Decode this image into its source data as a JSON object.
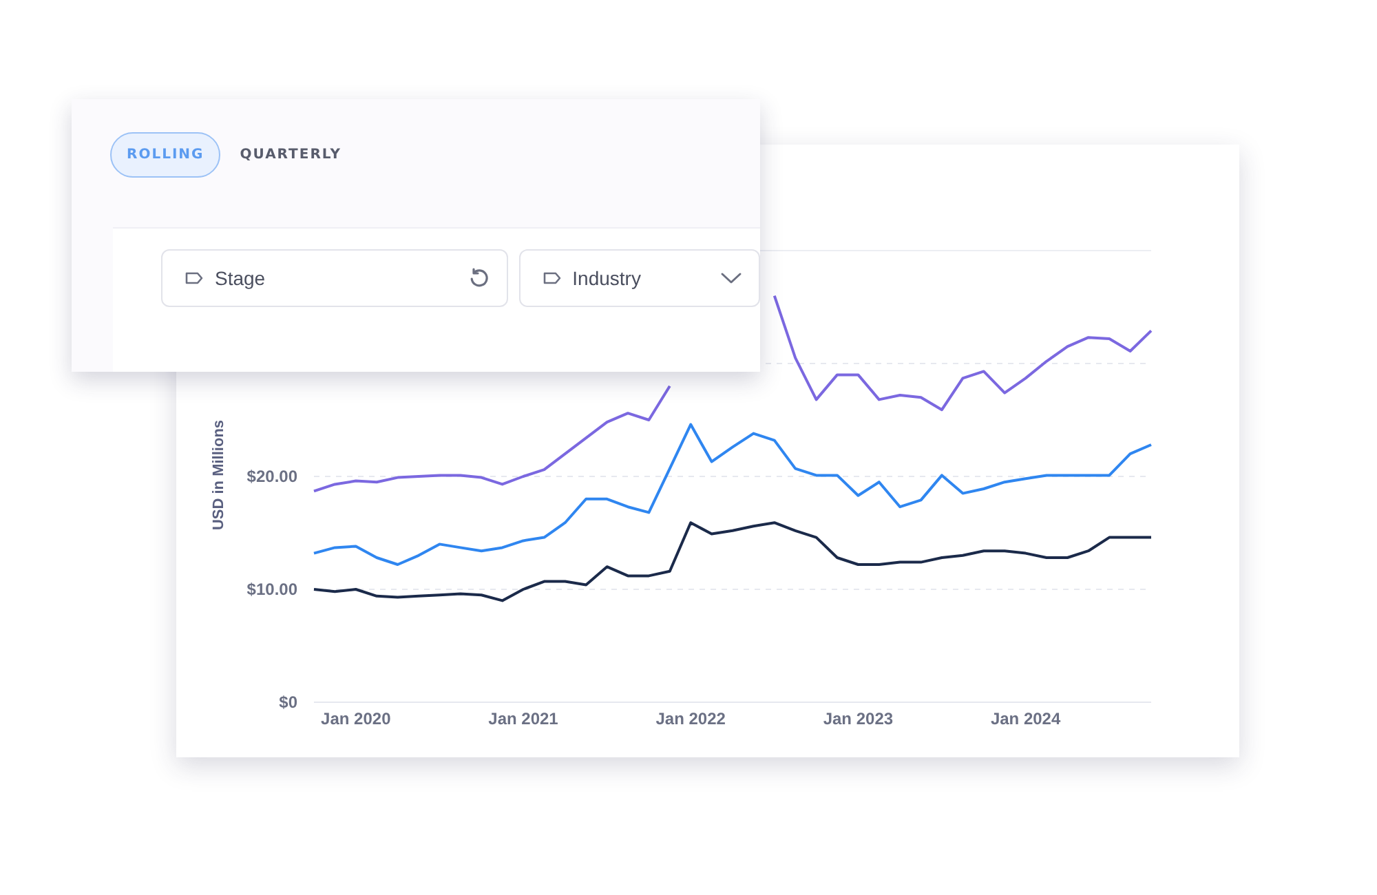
{
  "period_tabs": [
    {
      "label": "ROLLING",
      "selected": true
    },
    {
      "label": "QUARTERLY",
      "selected": false
    }
  ],
  "filters": [
    {
      "label": "Stage",
      "kind": "reset"
    },
    {
      "label": "Industry",
      "kind": "dropdown"
    }
  ],
  "chart": {
    "chart_data": {
      "type": "line",
      "ylabel": "USD in Millions",
      "categories": [
        null,
        null,
        "Jan 2020",
        null,
        null,
        null,
        null,
        null,
        null,
        null,
        "Jan 2021",
        null,
        null,
        null,
        null,
        null,
        null,
        null,
        "Jan 2022",
        null,
        null,
        null,
        null,
        null,
        null,
        null,
        "Jan 2023",
        null,
        null,
        null,
        null,
        null,
        null,
        null,
        "Jan 2024",
        null,
        null,
        null,
        null,
        null,
        null
      ],
      "series": [
        {
          "color": "#7b68e0",
          "values": [
            18.7,
            19.3,
            19.6,
            19.5,
            19.9,
            20,
            20.1,
            20.1,
            19.9,
            19.3,
            20,
            20.6,
            22,
            23.4,
            24.8,
            25.6,
            25,
            28,
            null,
            null,
            null,
            null,
            36,
            30.5,
            26.8,
            29,
            29,
            26.8,
            27.2,
            27,
            25.9,
            28.7,
            29.3,
            27.4,
            28.7,
            30.2,
            31.5,
            32.3,
            32.2,
            31.1,
            32.9
          ]
        },
        {
          "color": "#2f86f0",
          "values": [
            13.2,
            13.7,
            13.8,
            12.8,
            12.2,
            13,
            14,
            13.7,
            13.4,
            13.7,
            14.3,
            14.6,
            15.9,
            18,
            18,
            17.3,
            16.8,
            20.7,
            24.6,
            21.3,
            22.6,
            23.8,
            23.2,
            20.7,
            20.1,
            20.1,
            18.3,
            19.5,
            17.3,
            17.9,
            20.1,
            18.5,
            18.9,
            19.5,
            19.8,
            20.1,
            20.1,
            20.1,
            20.1,
            22,
            22.8
          ]
        },
        {
          "color": "#1b2a4a",
          "values": [
            10,
            9.8,
            10,
            9.4,
            9.3,
            9.4,
            9.5,
            9.6,
            9.5,
            9,
            10,
            10.7,
            10.7,
            10.4,
            12,
            11.2,
            11.2,
            11.6,
            15.9,
            14.9,
            15.2,
            15.6,
            15.9,
            15.2,
            14.6,
            12.8,
            12.2,
            12.2,
            12.4,
            12.4,
            12.8,
            13,
            13.4,
            13.4,
            13.2,
            12.8,
            12.8,
            13.4,
            14.6,
            14.6,
            14.6
          ]
        }
      ],
      "ylim": [
        0,
        40
      ],
      "yticks": [
        {
          "value": 0,
          "label": "$0"
        },
        {
          "value": 10,
          "label": "$10.00"
        },
        {
          "value": 20,
          "label": "$20.00"
        }
      ]
    }
  }
}
